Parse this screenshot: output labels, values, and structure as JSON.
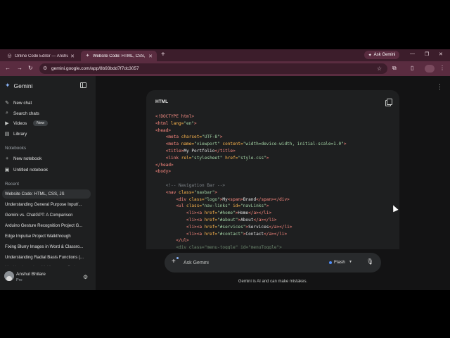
{
  "browser": {
    "tabs": [
      {
        "title": "Online Code Editor — Anshul B",
        "active": false
      },
      {
        "title": "Website Code: HTML, CSS, JS",
        "active": true
      }
    ],
    "ask_gemini_label": "Ask Gemini",
    "url": "gemini.google.com/app/8b93bdd7f7dc3057"
  },
  "sidebar": {
    "brand": "Gemini",
    "items": [
      {
        "label": "New chat",
        "icon": "pencil-icon"
      },
      {
        "label": "Search chats",
        "icon": "search-icon"
      },
      {
        "label": "Videos",
        "icon": "video-icon",
        "badge": "New"
      },
      {
        "label": "Library",
        "icon": "library-icon"
      }
    ],
    "notebooks_label": "Notebooks",
    "notebooks": [
      {
        "label": "New notebook",
        "icon": "plus-icon"
      },
      {
        "label": "Untitled notebook",
        "icon": "notebook-icon"
      }
    ],
    "recent_label": "Recent",
    "recent": [
      "Website Code: HTML, CSS, JS",
      "Understanding General Purpose Input/...",
      "Gemini vs. ChatGPT: A Comparison",
      "Arduino Gesture Recognition Project G...",
      "Edge Impulse Project Walkthrough",
      "Fixing Blurry Images in Word & Classro...",
      "Understanding Radial Basis Functions (...",
      "Machine Learning: McKinsey vs. Berlan..."
    ],
    "user": {
      "name": "Anshul Bhilare",
      "plan": "Pro"
    }
  },
  "code_block": {
    "language": "HTML",
    "lines": [
      [
        [
          "c-doc",
          "<!DOCTYPE html>"
        ]
      ],
      [
        [
          "c-tag",
          "<html "
        ],
        [
          "c-attr",
          "lang="
        ],
        [
          "c-str",
          "\"en\""
        ],
        [
          "c-tag",
          ">"
        ]
      ],
      [
        [
          "c-tag",
          "<head>"
        ]
      ],
      [
        [
          "c-txt",
          "    "
        ],
        [
          "c-tag",
          "<meta "
        ],
        [
          "c-attr",
          "charset="
        ],
        [
          "c-str",
          "\"UTF-8\""
        ],
        [
          "c-tag",
          ">"
        ]
      ],
      [
        [
          "c-txt",
          "    "
        ],
        [
          "c-tag",
          "<meta "
        ],
        [
          "c-attr",
          "name="
        ],
        [
          "c-str",
          "\"viewport\" "
        ],
        [
          "c-attr",
          "content="
        ],
        [
          "c-str",
          "\"width=device-width, initial-scale=1.0\""
        ],
        [
          "c-tag",
          ">"
        ]
      ],
      [
        [
          "c-txt",
          "    "
        ],
        [
          "c-tag",
          "<title>"
        ],
        [
          "c-txt",
          "My Portfolio"
        ],
        [
          "c-tag",
          "</title>"
        ]
      ],
      [
        [
          "c-txt",
          "    "
        ],
        [
          "c-tag",
          "<link "
        ],
        [
          "c-attr",
          "rel="
        ],
        [
          "c-str",
          "\"stylesheet\" "
        ],
        [
          "c-attr",
          "href="
        ],
        [
          "c-str",
          "\"style.css\""
        ],
        [
          "c-tag",
          ">"
        ]
      ],
      [
        [
          "c-tag",
          "</head>"
        ]
      ],
      [
        [
          "c-tag",
          "<body>"
        ]
      ],
      [
        [
          "c-txt",
          ""
        ]
      ],
      [
        [
          "c-txt",
          "    "
        ],
        [
          "c-com",
          "<!-- Navigation Bar -->"
        ]
      ],
      [
        [
          "c-txt",
          "    "
        ],
        [
          "c-tag",
          "<nav "
        ],
        [
          "c-attr",
          "class="
        ],
        [
          "c-str",
          "\"navbar\""
        ],
        [
          "c-tag",
          ">"
        ]
      ],
      [
        [
          "c-txt",
          "        "
        ],
        [
          "c-tag",
          "<div "
        ],
        [
          "c-attr",
          "class="
        ],
        [
          "c-str",
          "\"logo\""
        ],
        [
          "c-tag",
          ">"
        ],
        [
          "c-txt",
          "My"
        ],
        [
          "c-tag",
          "<span>"
        ],
        [
          "c-txt",
          "Brand"
        ],
        [
          "c-tag",
          "</span></div>"
        ]
      ],
      [
        [
          "c-txt",
          "        "
        ],
        [
          "c-tag",
          "<ul "
        ],
        [
          "c-attr",
          "class="
        ],
        [
          "c-str",
          "\"nav-links\" "
        ],
        [
          "c-attr",
          "id="
        ],
        [
          "c-str",
          "\"navLinks\""
        ],
        [
          "c-tag",
          ">"
        ]
      ],
      [
        [
          "c-txt",
          "            "
        ],
        [
          "c-tag",
          "<li><a "
        ],
        [
          "c-attr",
          "href="
        ],
        [
          "c-str",
          "\"#home\""
        ],
        [
          "c-tag",
          ">"
        ],
        [
          "c-txt",
          "Home"
        ],
        [
          "c-tag",
          "</a></li>"
        ]
      ],
      [
        [
          "c-txt",
          "            "
        ],
        [
          "c-tag",
          "<li><a "
        ],
        [
          "c-attr",
          "href="
        ],
        [
          "c-str",
          "\"#about\""
        ],
        [
          "c-tag",
          ">"
        ],
        [
          "c-txt",
          "About"
        ],
        [
          "c-tag",
          "</a></li>"
        ]
      ],
      [
        [
          "c-txt",
          "            "
        ],
        [
          "c-tag",
          "<li><a "
        ],
        [
          "c-attr",
          "href="
        ],
        [
          "c-str",
          "\"#services\""
        ],
        [
          "c-tag",
          ">"
        ],
        [
          "c-txt",
          "Services"
        ],
        [
          "c-tag",
          "</a></li>"
        ]
      ],
      [
        [
          "c-txt",
          "            "
        ],
        [
          "c-tag",
          "<li><a "
        ],
        [
          "c-attr",
          "href="
        ],
        [
          "c-str",
          "\"#contact\""
        ],
        [
          "c-tag",
          ">"
        ],
        [
          "c-txt",
          "Contact"
        ],
        [
          "c-tag",
          "</a></li>"
        ]
      ],
      [
        [
          "c-txt",
          "        "
        ],
        [
          "c-tag",
          "</ul>"
        ]
      ],
      [
        [
          "c-txt",
          "        "
        ],
        [
          "c-faint",
          "<div class=\"menu-toggle\" id=\"menuToggle\">"
        ]
      ]
    ]
  },
  "input": {
    "placeholder": "Ask Gemini",
    "model_label": "Flash"
  },
  "disclaimer": "Gemini is AI and can make mistakes."
}
